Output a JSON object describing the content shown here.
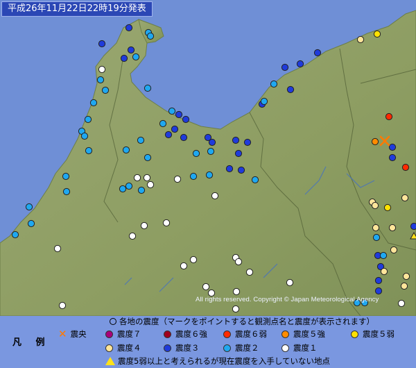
{
  "title": "平成26年11月22日22時19分発表",
  "copyright": "All rights reserved. Copyright © Japan Meteorological Agency",
  "legend": {
    "caption": "凡 例",
    "header": "各地の震度（マークをポイントすると観測点名と震度が表示されます）",
    "epicenter_label": "震央",
    "items": [
      {
        "key": "7",
        "label": "震度７",
        "color": "#a8007a"
      },
      {
        "key": "6+",
        "label": "震度６強",
        "color": "#a0001e"
      },
      {
        "key": "6-",
        "label": "震度６弱",
        "color": "#ff2a00"
      },
      {
        "key": "5+",
        "label": "震度５強",
        "color": "#ff8c00"
      },
      {
        "key": "5-",
        "label": "震度５弱",
        "color": "#ffe100"
      },
      {
        "key": "4",
        "label": "震度４",
        "color": "#ffe59a"
      },
      {
        "key": "3",
        "label": "震度３",
        "color": "#1f3bdb"
      },
      {
        "key": "2",
        "label": "震度２",
        "color": "#1fa8f0"
      },
      {
        "key": "1",
        "label": "震度１",
        "color": "#ffffff"
      }
    ],
    "unreported_label": "震度5弱以上と考えられるが現在震度を入手していない地点"
  },
  "colors": {
    "sea": "#6f8fd6",
    "land": "#93a46b",
    "epicenter": "#ff7a00"
  }
}
